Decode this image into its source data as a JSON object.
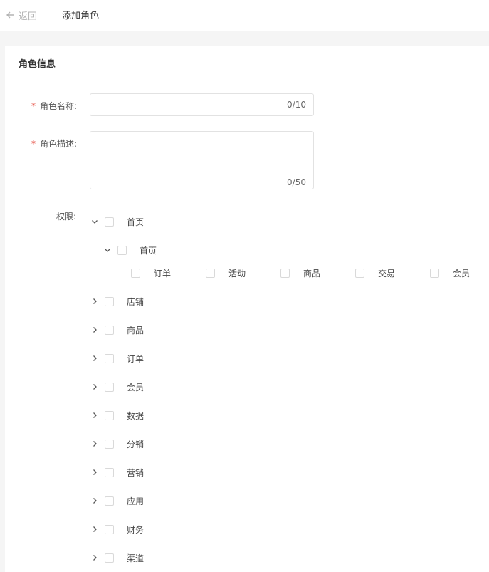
{
  "header": {
    "back_label": "返回",
    "title": "添加角色"
  },
  "card": {
    "title": "角色信息"
  },
  "form": {
    "name": {
      "required_mark": "*",
      "label": "角色名称:",
      "value": "",
      "counter": "0/10"
    },
    "desc": {
      "required_mark": "*",
      "label": "角色描述:",
      "value": "",
      "counter": "0/50"
    },
    "perm_label": "权限:"
  },
  "permissions": {
    "root": {
      "label": "首页",
      "expanded": true
    },
    "child": {
      "label": "首页",
      "expanded": true
    },
    "leaves": [
      "订单",
      "活动",
      "商品",
      "交易",
      "会员"
    ],
    "collapsed": [
      "店铺",
      "商品",
      "订单",
      "会员",
      "数据",
      "分销",
      "营销",
      "应用",
      "财务",
      "渠道"
    ]
  },
  "icons": {
    "back": "arrow-left-icon",
    "expanded": "chevron-down-icon",
    "collapsed": "chevron-right-icon"
  },
  "colors": {
    "required": "#e54d42",
    "border": "#e2e2e2",
    "muted": "#b4b4b4"
  }
}
